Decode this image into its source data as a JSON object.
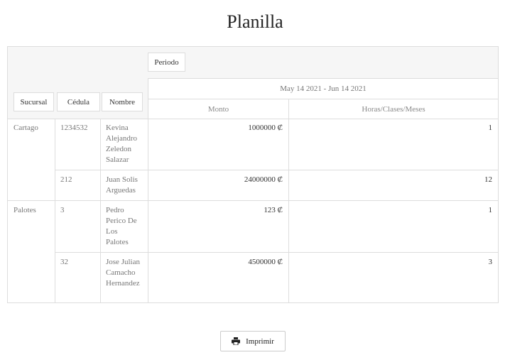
{
  "page": {
    "title": "Planilla"
  },
  "pivot": {
    "filter_chip": "Periodo",
    "row_headers": [
      "Sucursal",
      "Cédula",
      "Nombre"
    ],
    "period": "May 14 2021 - Jun 14 2021",
    "measures": [
      "Monto",
      "Horas/Clases/Meses"
    ],
    "groups": [
      {
        "sucursal": "Cartago",
        "rows": [
          {
            "cedula": "1234532",
            "nombre": "Kevina Alejandro Zeledon Salazar",
            "monto": "1000000 ₡",
            "horas": "1"
          },
          {
            "cedula": "212",
            "nombre": "Juan Solis Arguedas",
            "monto": "24000000 ₡",
            "horas": "12"
          }
        ]
      },
      {
        "sucursal": "Palotes",
        "rows": [
          {
            "cedula": "3",
            "nombre": "Pedro Perico De Los Palotes",
            "monto": "123 ₡",
            "horas": "1"
          },
          {
            "cedula": "32",
            "nombre": "Jose Julian Camacho Hernandez",
            "monto": "4500000 ₡",
            "horas": "3"
          }
        ]
      }
    ]
  },
  "actions": {
    "print_label": "Imprimir",
    "print_icon": "printer-icon"
  }
}
